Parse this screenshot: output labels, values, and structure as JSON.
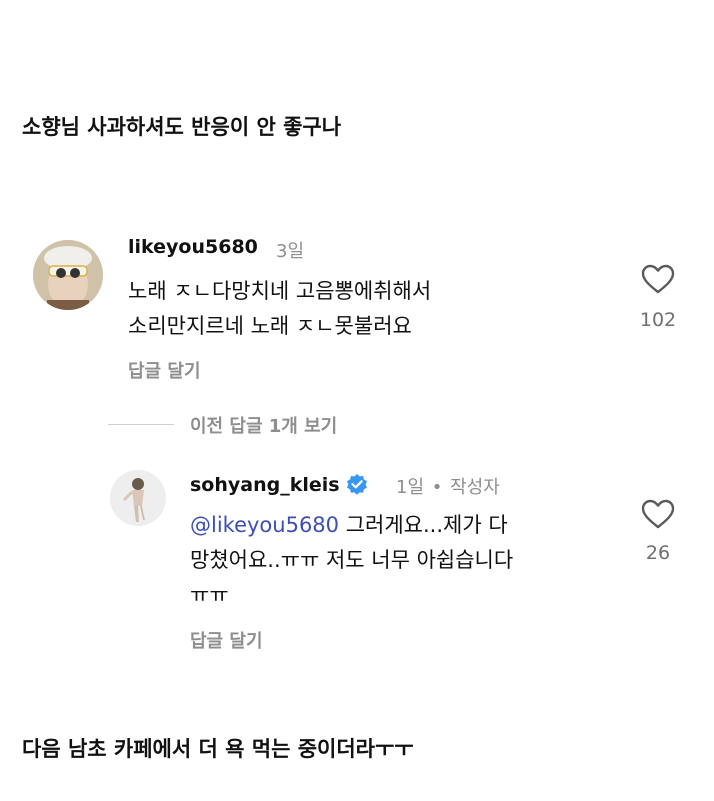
{
  "caption_top": "소향님 사과하셔도 반응이 안 좋구나",
  "caption_bottom": "다음 남초 카페에서 더 욕 먹는 중이더라ㅜㅜ",
  "comment1": {
    "username": "likeyou5680",
    "time": "3일",
    "line1": "노래 ㅈㄴ다망치네 고음뽕에취해서",
    "line2": "소리만지르네 노래 ㅈㄴ못불러요",
    "reply_label": "답글 달기",
    "likes": "102"
  },
  "view_replies": "이전 답글 1개 보기",
  "reply1": {
    "username": "sohyang_kleis",
    "time": "1일",
    "dot": "•",
    "author_tag": "작성자",
    "mention": "@likeyou5680",
    "line1_rest": " 그러게요...제가 다",
    "line2": "망쳤어요..ㅠㅠ 저도 너무 아쉽습니다",
    "line3": "ㅠㅠ",
    "reply_label": "답글 달기",
    "likes": "26"
  },
  "colors": {
    "verified": "#3897f0",
    "mention": "#3d4fb5",
    "muted": "#8e8e8e"
  },
  "icons": [
    "heart-icon",
    "verified-badge-icon"
  ]
}
